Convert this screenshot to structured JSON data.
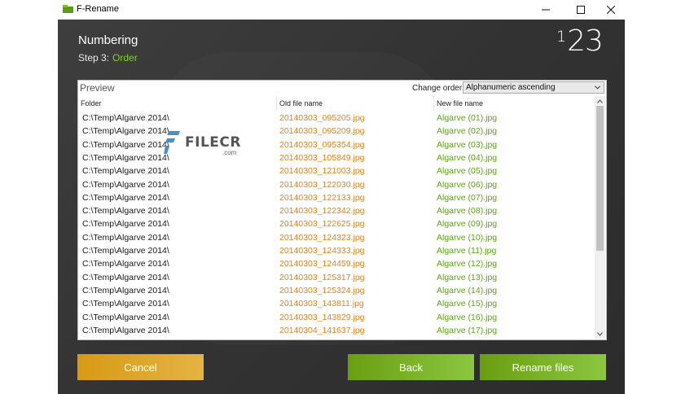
{
  "window": {
    "title": "F-Rename",
    "controls": [
      "minimize-icon",
      "maximize-icon",
      "close-icon"
    ]
  },
  "header": {
    "title": "Numbering",
    "step_label": "Step 3:",
    "step_name": "Order",
    "badge_sup": "1",
    "badge_main": "23"
  },
  "preview": {
    "label": "Preview",
    "order_label": "Change order:",
    "order_value": "Alphanumeric ascending",
    "columns": [
      "Folder",
      "Old file name",
      "New file name"
    ]
  },
  "rows": [
    {
      "folder": "C:\\Temp\\Algarve 2014\\",
      "old": "20140303_095205.jpg",
      "new": "Algarve (01).jpg"
    },
    {
      "folder": "C:\\Temp\\Algarve 2014\\",
      "old": "20140303_095209.jpg",
      "new": "Algarve (02).jpg"
    },
    {
      "folder": "C:\\Temp\\Algarve 2014\\",
      "old": "20140303_095354.jpg",
      "new": "Algarve (03).jpg"
    },
    {
      "folder": "C:\\Temp\\Algarve 2014\\",
      "old": "20140303_105849.jpg",
      "new": "Algarve (04).jpg"
    },
    {
      "folder": "C:\\Temp\\Algarve 2014\\",
      "old": "20140303_121003.jpg",
      "new": "Algarve (05).jpg"
    },
    {
      "folder": "C:\\Temp\\Algarve 2014\\",
      "old": "20140303_122030.jpg",
      "new": "Algarve (06).jpg"
    },
    {
      "folder": "C:\\Temp\\Algarve 2014\\",
      "old": "20140303_122133.jpg",
      "new": "Algarve (07).jpg"
    },
    {
      "folder": "C:\\Temp\\Algarve 2014\\",
      "old": "20140303_122342.jpg",
      "new": "Algarve (08).jpg"
    },
    {
      "folder": "C:\\Temp\\Algarve 2014\\",
      "old": "20140303_122625.jpg",
      "new": "Algarve (09).jpg"
    },
    {
      "folder": "C:\\Temp\\Algarve 2014\\",
      "old": "20140303_124323.jpg",
      "new": "Algarve (10).jpg"
    },
    {
      "folder": "C:\\Temp\\Algarve 2014\\",
      "old": "20140303_124333.jpg",
      "new": "Algarve (11).jpg"
    },
    {
      "folder": "C:\\Temp\\Algarve 2014\\",
      "old": "20140303_124459.jpg",
      "new": "Algarve (12).jpg"
    },
    {
      "folder": "C:\\Temp\\Algarve 2014\\",
      "old": "20140303_125317.jpg",
      "new": "Algarve (13).jpg"
    },
    {
      "folder": "C:\\Temp\\Algarve 2014\\",
      "old": "20140303_125324.jpg",
      "new": "Algarve (14).jpg"
    },
    {
      "folder": "C:\\Temp\\Algarve 2014\\",
      "old": "20140303_143811.jpg",
      "new": "Algarve (15).jpg"
    },
    {
      "folder": "C:\\Temp\\Algarve 2014\\",
      "old": "20140303_143829.jpg",
      "new": "Algarve (16).jpg"
    },
    {
      "folder": "C:\\Temp\\Algarve 2014\\",
      "old": "20140304_141637.jpg",
      "new": "Algarve (17).jpg"
    }
  ],
  "watermark": {
    "text": "FILECR",
    "suffix": ".com"
  },
  "buttons": {
    "cancel": "Cancel",
    "back": "Back",
    "rename": "Rename files"
  },
  "colors": {
    "background": "#3a3a3a",
    "step_accent": "#7ed321",
    "old_name": "#e8811a",
    "new_name": "#5aa615",
    "cancel": "#d89a13",
    "primary": "#7bb324"
  }
}
